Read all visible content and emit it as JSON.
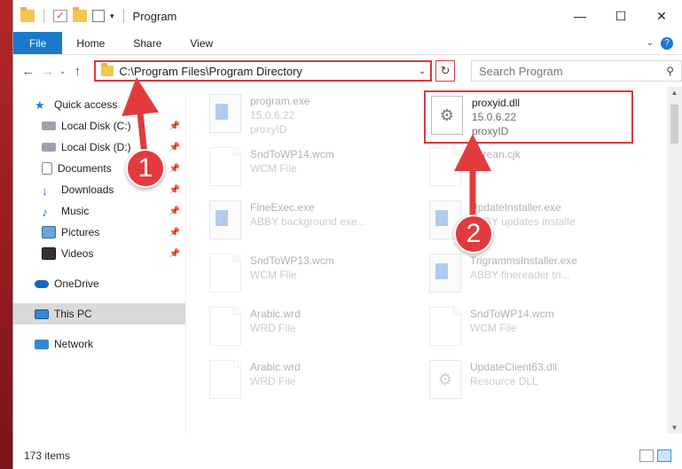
{
  "window": {
    "title": "Program",
    "controls": {
      "minimize": "—",
      "maximize": "☐",
      "close": "✕"
    }
  },
  "ribbon": {
    "tabs": [
      "File",
      "Home",
      "Share",
      "View"
    ]
  },
  "address": {
    "path": "C:\\Program Files\\Program Directory",
    "search_placeholder": "Search Program"
  },
  "nav": {
    "quick_access": "Quick access",
    "items": [
      {
        "label": "Local Disk (C:)",
        "icon": "disk-icon"
      },
      {
        "label": "Local Disk (D:)",
        "icon": "disk-icon"
      },
      {
        "label": "Documents",
        "icon": "documents-icon"
      },
      {
        "label": "Downloads",
        "icon": "downloads-icon"
      },
      {
        "label": "Music",
        "icon": "music-icon"
      },
      {
        "label": "Pictures",
        "icon": "pictures-icon"
      },
      {
        "label": "Videos",
        "icon": "videos-icon"
      }
    ],
    "onedrive": "OneDrive",
    "this_pc": "This PC",
    "network": "Network"
  },
  "files": [
    {
      "name": "program.exe",
      "line2": "15.0.6.22",
      "line3": "proxyID",
      "icon": "exe-icon",
      "col": 0,
      "row": 0,
      "faded": true
    },
    {
      "name": "proxyid.dll",
      "line2": "15.0.6.22",
      "line3": "proxyID",
      "icon": "gear-icon",
      "col": 1,
      "row": 0,
      "faded": false,
      "highlight": true
    },
    {
      "name": "SndToWP14.wcm",
      "line2": "WCM File",
      "line3": "",
      "icon": "doc-icon",
      "col": 0,
      "row": 1,
      "faded": true
    },
    {
      "name": "Korean.cjk",
      "line2": "",
      "line3": "",
      "icon": "doc-icon",
      "col": 1,
      "row": 1,
      "faded": true
    },
    {
      "name": "FineExec.exe",
      "line2": "ABBY background exe...",
      "line3": "",
      "icon": "exe-icon",
      "col": 0,
      "row": 2,
      "faded": true
    },
    {
      "name": "UpdateInstaller.exe",
      "line2": "ABBY updates installe",
      "line3": "",
      "icon": "exe-icon",
      "col": 1,
      "row": 2,
      "faded": true
    },
    {
      "name": "SndToWP13.wcm",
      "line2": "WCM File",
      "line3": "",
      "icon": "doc-icon",
      "col": 0,
      "row": 3,
      "faded": true
    },
    {
      "name": "TrigrammsInstaller.exe",
      "line2": "ABBY finereader tri...",
      "line3": "",
      "icon": "exe-icon",
      "col": 1,
      "row": 3,
      "faded": true
    },
    {
      "name": "Arabic.wrd",
      "line2": "WRD File",
      "line3": "",
      "icon": "doc-icon",
      "col": 0,
      "row": 4,
      "faded": true
    },
    {
      "name": "SndToWP14.wcm",
      "line2": "WCM File",
      "line3": "",
      "icon": "doc-icon",
      "col": 1,
      "row": 4,
      "faded": true
    },
    {
      "name": "Arabic.wrd",
      "line2": "WRD File",
      "line3": "",
      "icon": "doc-icon",
      "col": 0,
      "row": 5,
      "faded": true
    },
    {
      "name": "UpdateClient63.dll",
      "line2": "Resource DLL",
      "line3": "",
      "icon": "gear-icon",
      "col": 1,
      "row": 5,
      "faded": true
    }
  ],
  "status": {
    "items": "173 items"
  },
  "callouts": [
    "1",
    "2"
  ],
  "colors": {
    "accent": "#1979ca",
    "highlight": "#d9393b"
  }
}
